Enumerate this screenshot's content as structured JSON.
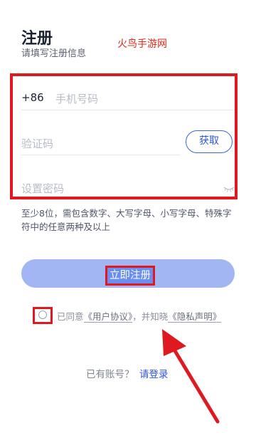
{
  "header": {
    "title": "注册",
    "subtitle": "请填写注册信息",
    "watermark": "火鸟手游网"
  },
  "form": {
    "country_code": "+86",
    "phone_placeholder": "手机号码",
    "code_placeholder": "验证码",
    "get_code_label": "获取",
    "password_placeholder": "设置密码",
    "password_hint": "至少8位，需包含数字、大写字母、小写字母、特殊字符中的任意两种及以上"
  },
  "register_button": "立即注册",
  "agreement": {
    "prefix": "已同意",
    "user_agreement": "《用户协议》",
    "middle": "，并知晓",
    "privacy": "《隐私声明》"
  },
  "footer": {
    "prompt": "已有账号？",
    "login_link": "请登录"
  },
  "colors": {
    "accent": "#2f55e6",
    "button_bg": "#a3b6f4",
    "annotation_red": "#e01820"
  },
  "icons": {
    "password_visibility": "eye-closed-icon",
    "agree": "radio-icon"
  }
}
